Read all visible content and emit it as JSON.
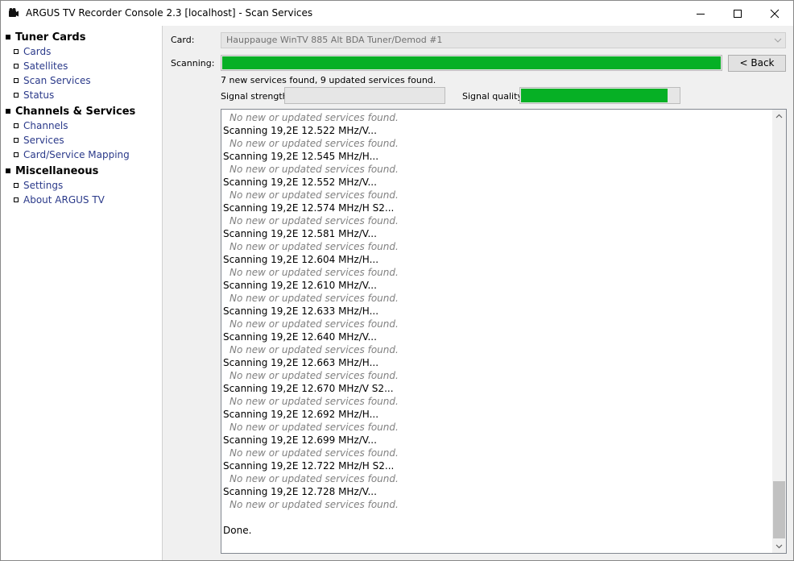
{
  "window": {
    "title": "ARGUS TV Recorder Console 2.3 [localhost] - Scan Services",
    "app_icon": "film-camera-icon",
    "controls": [
      "minimize-icon",
      "maximize-icon",
      "close-icon"
    ]
  },
  "sidebar": {
    "sections": [
      {
        "title": "Tuner Cards",
        "items": [
          "Cards",
          "Satellites",
          "Scan Services",
          "Status"
        ]
      },
      {
        "title": "Channels & Services",
        "items": [
          "Channels",
          "Services",
          "Card/Service Mapping"
        ]
      },
      {
        "title": "Miscellaneous",
        "items": [
          "Settings",
          "About ARGUS TV"
        ]
      }
    ]
  },
  "main": {
    "card_label": "Card:",
    "card_value": "Hauppauge WinTV 885 Alt BDA Tuner/Demod #1",
    "scanning_label": "Scanning:",
    "scan_progress": 1.0,
    "back_label": "< Back",
    "status": "7 new services found, 9 updated services found.",
    "signal_strength_label": "Signal strength:",
    "signal_strength": 0.0,
    "signal_quality_label": "Signal quality:",
    "signal_quality": 0.93
  },
  "log": {
    "lines": [
      {
        "kind": "note",
        "text": "No new or updated services found."
      },
      {
        "kind": "scan",
        "text": "Scanning 19,2E 12.522 MHz/V..."
      },
      {
        "kind": "note",
        "text": "No new or updated services found."
      },
      {
        "kind": "scan",
        "text": "Scanning 19,2E 12.545 MHz/H..."
      },
      {
        "kind": "note",
        "text": "No new or updated services found."
      },
      {
        "kind": "scan",
        "text": "Scanning 19,2E 12.552 MHz/V..."
      },
      {
        "kind": "note",
        "text": "No new or updated services found."
      },
      {
        "kind": "scan",
        "text": "Scanning 19,2E 12.574 MHz/H S2..."
      },
      {
        "kind": "note",
        "text": "No new or updated services found."
      },
      {
        "kind": "scan",
        "text": "Scanning 19,2E 12.581 MHz/V..."
      },
      {
        "kind": "note",
        "text": "No new or updated services found."
      },
      {
        "kind": "scan",
        "text": "Scanning 19,2E 12.604 MHz/H..."
      },
      {
        "kind": "note",
        "text": "No new or updated services found."
      },
      {
        "kind": "scan",
        "text": "Scanning 19,2E 12.610 MHz/V..."
      },
      {
        "kind": "note",
        "text": "No new or updated services found."
      },
      {
        "kind": "scan",
        "text": "Scanning 19,2E 12.633 MHz/H..."
      },
      {
        "kind": "note",
        "text": "No new or updated services found."
      },
      {
        "kind": "scan",
        "text": "Scanning 19,2E 12.640 MHz/V..."
      },
      {
        "kind": "note",
        "text": "No new or updated services found."
      },
      {
        "kind": "scan",
        "text": "Scanning 19,2E 12.663 MHz/H..."
      },
      {
        "kind": "note",
        "text": "No new or updated services found."
      },
      {
        "kind": "scan",
        "text": "Scanning 19,2E 12.670 MHz/V S2..."
      },
      {
        "kind": "note",
        "text": "No new or updated services found."
      },
      {
        "kind": "scan",
        "text": "Scanning 19,2E 12.692 MHz/H..."
      },
      {
        "kind": "note",
        "text": "No new or updated services found."
      },
      {
        "kind": "scan",
        "text": "Scanning 19,2E 12.699 MHz/V..."
      },
      {
        "kind": "note",
        "text": "No new or updated services found."
      },
      {
        "kind": "scan",
        "text": "Scanning 19,2E 12.722 MHz/H S2..."
      },
      {
        "kind": "note",
        "text": "No new or updated services found."
      },
      {
        "kind": "scan",
        "text": "Scanning 19,2E 12.728 MHz/V..."
      },
      {
        "kind": "note",
        "text": "No new or updated services found."
      },
      {
        "kind": "blank",
        "text": ""
      },
      {
        "kind": "scan",
        "text": "Done."
      }
    ]
  },
  "colors": {
    "progress_green": "#06b025",
    "link_blue": "#2b3a8a",
    "note_gray": "#808080"
  }
}
